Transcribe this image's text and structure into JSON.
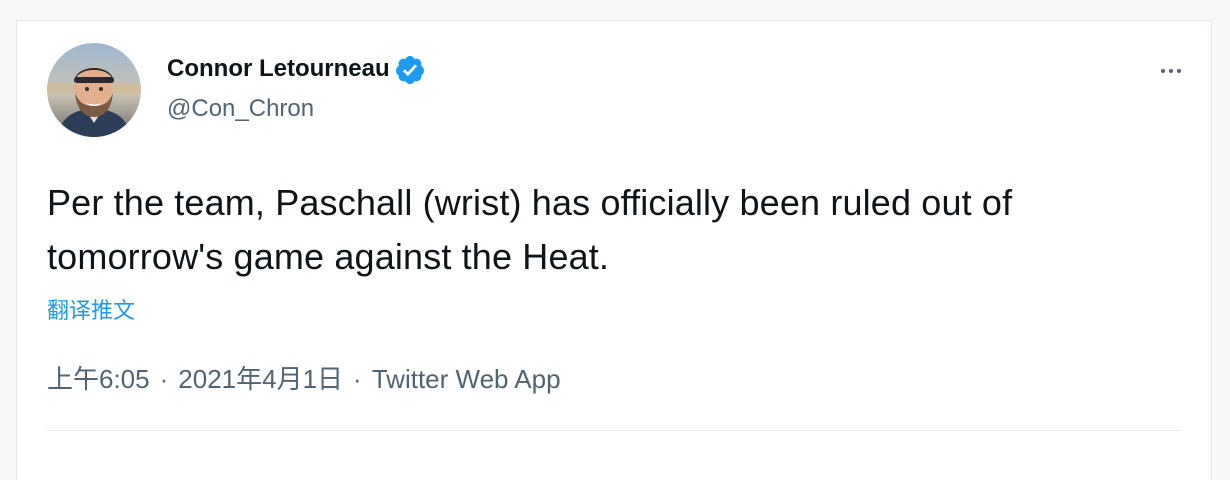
{
  "tweet": {
    "author_name": "Connor Letourneau",
    "handle": "@Con_Chron",
    "verified": true,
    "text": "Per the team, Paschall (wrist) has officially been ruled out of tomorrow's game against the Heat.",
    "translate_label": "翻译推文",
    "time": "上午6:05",
    "date": "2021年4月1日",
    "separator": "·",
    "source": "Twitter Web App"
  },
  "icons": {
    "verified": "verified-badge-icon",
    "more": "more-options-icon"
  },
  "colors": {
    "accent": "#1d9bf0",
    "secondary_text": "#536471",
    "primary_text": "#0f1419"
  }
}
